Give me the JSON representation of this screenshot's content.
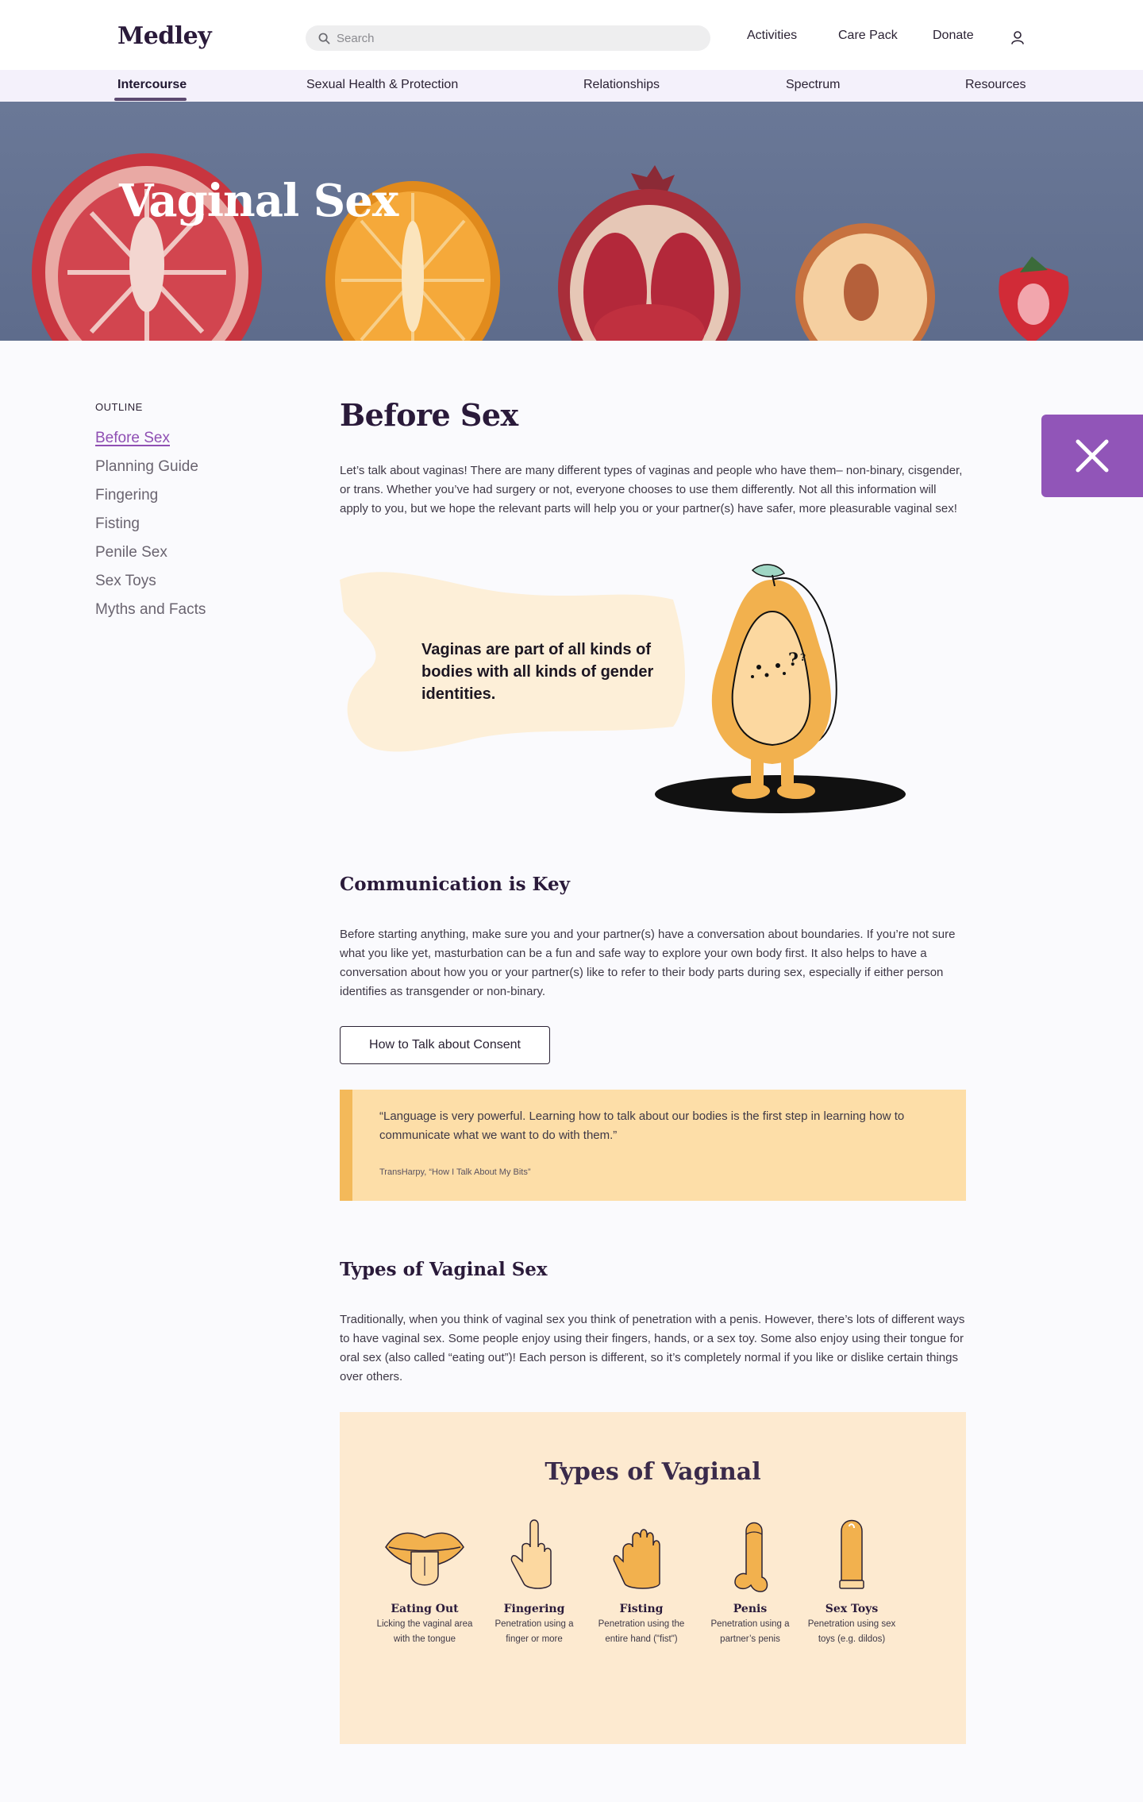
{
  "header": {
    "logo": "Medley",
    "search_placeholder": "Search",
    "nav": [
      "Activities",
      "Care Pack",
      "Donate"
    ]
  },
  "subnav": {
    "items": [
      "Intercourse",
      "Sexual Health & Protection",
      "Relationships",
      "Spectrum",
      "Resources"
    ],
    "active": "Intercourse"
  },
  "hero": {
    "title": "Vaginal Sex"
  },
  "outline": {
    "heading": "OUTLINE",
    "items": [
      "Before Sex",
      "Planning Guide",
      "Fingering",
      "Fisting",
      "Penile Sex",
      "Sex Toys",
      "Myths and Facts"
    ],
    "current": "Before Sex"
  },
  "before_sex": {
    "title": "Before Sex",
    "intro": "Let’s talk about vaginas! There are many different types of vaginas and people who have them– non-binary, cisgender, or trans. Whether you’ve had surgery or not, everyone chooses to use them differently. Not all this information will apply to you, but we hope the relevant parts will help you or your partner(s) have safer, more pleasurable vaginal sex!",
    "callout": "Vaginas are part of all kinds of bodies with all kinds of gender identities."
  },
  "communication": {
    "title": "Communication is Key",
    "body": "Before starting anything, make sure you and your partner(s) have a conversation about boundaries. If you’re not sure what you like yet, masturbation can be a fun and safe way to explore your own body first. It also helps to have a conversation about how you or your partner(s) like to refer to their body parts during sex, especially if either person identifies as transgender or non-binary.",
    "button": "How to Talk about Consent",
    "quote": "“Language is very powerful. Learning how to talk about our bodies is the first step in learning how to communicate what we want to do with them.”",
    "quote_source": "TransHarpy, “How I Talk About My Bits”"
  },
  "types": {
    "title": "Types of Vaginal Sex",
    "body": "Traditionally, when you think of vaginal sex you think of penetration with a penis. However, there’s lots of different ways to have vaginal sex. Some people enjoy using their fingers, hands, or a sex toy. Some also enjoy using their tongue for oral sex (also called “eating out”)! Each person is different, so it’s completely normal if you like or dislike certain things over others.",
    "card_title": "Types of Vaginal",
    "items": [
      {
        "name": "Eating Out",
        "desc": "Licking the vaginal area with the tongue",
        "icon": "lips-tongue-icon"
      },
      {
        "name": "Fingering",
        "desc": "Penetration using a finger or more",
        "icon": "finger-hand-icon"
      },
      {
        "name": "Fisting",
        "desc": "Penetration using the entire hand (\"fist\")",
        "icon": "fist-icon"
      },
      {
        "name": "Penis",
        "desc": "Penetration using a partner’s penis",
        "icon": "penis-icon"
      },
      {
        "name": "Sex Toys",
        "desc": "Penetration using sex toys (e.g. dildos)",
        "icon": "dildo-icon"
      }
    ]
  },
  "colors": {
    "accent": "#9155b8",
    "hero_bg": "#6a7897",
    "quote_bg": "#fddea8",
    "quote_bar": "#f3b95a",
    "types_bg": "#fdead0"
  }
}
